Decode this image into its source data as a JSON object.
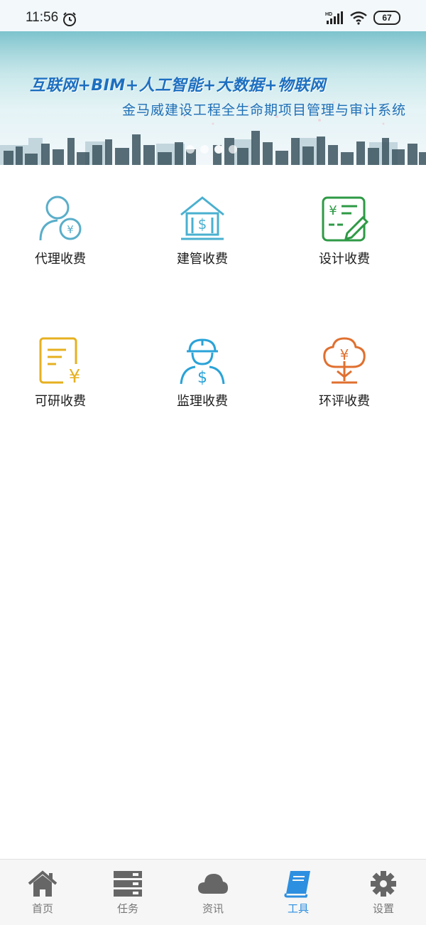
{
  "status": {
    "time": "11:56",
    "battery": "67",
    "hd": "HD"
  },
  "banner": {
    "line1": "互联网+BIM+人工智能+大数据+物联网",
    "line2": "金马威建设工程全生命期项目管理与审计系统"
  },
  "tiles": [
    {
      "label": "代理收费",
      "icon": "person-yuan-icon",
      "color": "#5aaec9"
    },
    {
      "label": "建管收费",
      "icon": "house-dollar-icon",
      "color": "#4ab0d0"
    },
    {
      "label": "设计收费",
      "icon": "document-pen-icon",
      "color": "#2e9a45"
    },
    {
      "label": "可研收费",
      "icon": "report-yuan-icon",
      "color": "#e6b020"
    },
    {
      "label": "监理收费",
      "icon": "worker-helmet-icon",
      "color": "#2aa3d8"
    },
    {
      "label": "环评收费",
      "icon": "tree-yuan-icon",
      "color": "#e07030"
    }
  ],
  "tabs": [
    {
      "label": "首页",
      "icon": "home-icon",
      "active": false
    },
    {
      "label": "任务",
      "icon": "server-icon",
      "active": false
    },
    {
      "label": "资讯",
      "icon": "cloud-icon",
      "active": false
    },
    {
      "label": "工具",
      "icon": "book-icon",
      "active": true
    },
    {
      "label": "设置",
      "icon": "gear-icon",
      "active": false
    }
  ]
}
